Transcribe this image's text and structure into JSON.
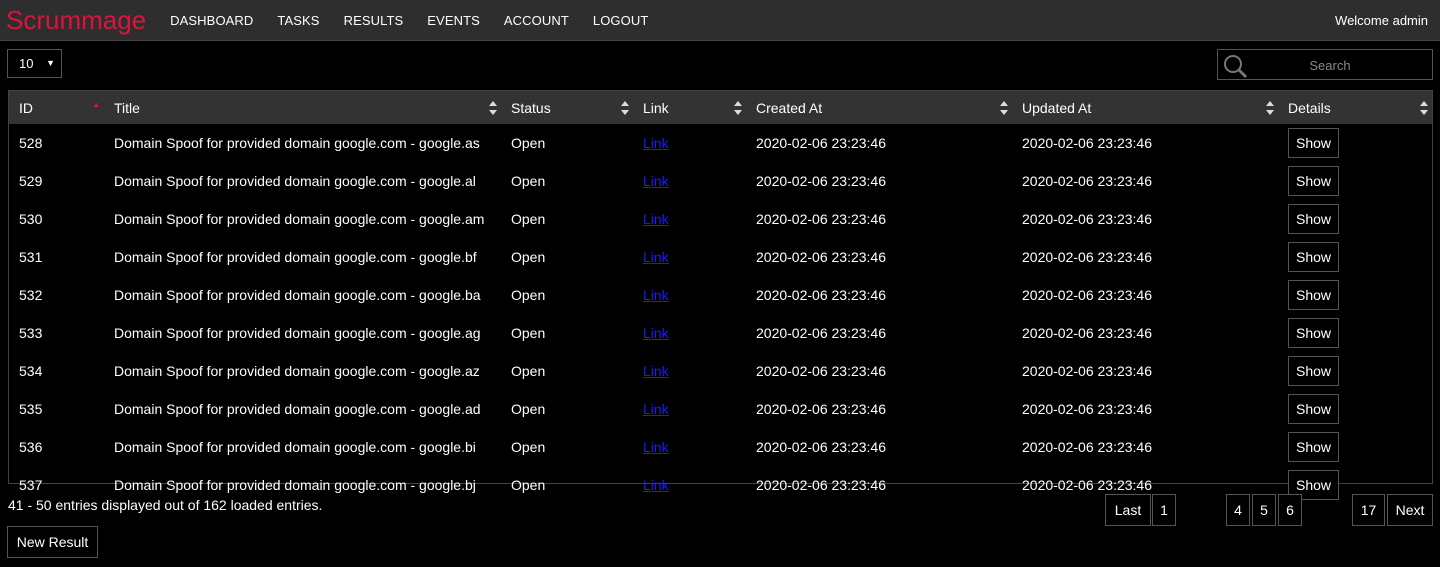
{
  "nav": {
    "brand": "Scrummage",
    "items": [
      "DASHBOARD",
      "TASKS",
      "RESULTS",
      "EVENTS",
      "ACCOUNT",
      "LOGOUT"
    ],
    "welcome": "Welcome admin"
  },
  "controls": {
    "page_size": "10",
    "search_placeholder": "Search"
  },
  "table": {
    "columns": [
      "ID",
      "Title",
      "Status",
      "Link",
      "Created At",
      "Updated At",
      "Details"
    ],
    "rows": [
      {
        "id": "528",
        "title": "Domain Spoof for provided domain google.com - google.as",
        "status": "Open",
        "link": "Link",
        "created": "2020-02-06 23:23:46",
        "updated": "2020-02-06 23:23:46",
        "details": "Show"
      },
      {
        "id": "529",
        "title": "Domain Spoof for provided domain google.com - google.al",
        "status": "Open",
        "link": "Link",
        "created": "2020-02-06 23:23:46",
        "updated": "2020-02-06 23:23:46",
        "details": "Show"
      },
      {
        "id": "530",
        "title": "Domain Spoof for provided domain google.com - google.am",
        "status": "Open",
        "link": "Link",
        "created": "2020-02-06 23:23:46",
        "updated": "2020-02-06 23:23:46",
        "details": "Show"
      },
      {
        "id": "531",
        "title": "Domain Spoof for provided domain google.com - google.bf",
        "status": "Open",
        "link": "Link",
        "created": "2020-02-06 23:23:46",
        "updated": "2020-02-06 23:23:46",
        "details": "Show"
      },
      {
        "id": "532",
        "title": "Domain Spoof for provided domain google.com - google.ba",
        "status": "Open",
        "link": "Link",
        "created": "2020-02-06 23:23:46",
        "updated": "2020-02-06 23:23:46",
        "details": "Show"
      },
      {
        "id": "533",
        "title": "Domain Spoof for provided domain google.com - google.ag",
        "status": "Open",
        "link": "Link",
        "created": "2020-02-06 23:23:46",
        "updated": "2020-02-06 23:23:46",
        "details": "Show"
      },
      {
        "id": "534",
        "title": "Domain Spoof for provided domain google.com - google.az",
        "status": "Open",
        "link": "Link",
        "created": "2020-02-06 23:23:46",
        "updated": "2020-02-06 23:23:46",
        "details": "Show"
      },
      {
        "id": "535",
        "title": "Domain Spoof for provided domain google.com - google.ad",
        "status": "Open",
        "link": "Link",
        "created": "2020-02-06 23:23:46",
        "updated": "2020-02-06 23:23:46",
        "details": "Show"
      },
      {
        "id": "536",
        "title": "Domain Spoof for provided domain google.com - google.bi",
        "status": "Open",
        "link": "Link",
        "created": "2020-02-06 23:23:46",
        "updated": "2020-02-06 23:23:46",
        "details": "Show"
      },
      {
        "id": "537",
        "title": "Domain Spoof for provided domain google.com - google.bj",
        "status": "Open",
        "link": "Link",
        "created": "2020-02-06 23:23:46",
        "updated": "2020-02-06 23:23:46",
        "details": "Show"
      }
    ]
  },
  "footer": {
    "summary": "41 - 50 entries displayed out of 162 loaded entries.",
    "new_result": "New Result"
  },
  "pagination": [
    "Last",
    "1",
    "4",
    "5",
    "6",
    "17",
    "Next"
  ],
  "colors": {
    "brand": "#dc143c",
    "link": "#1a1aff",
    "background": "#000000",
    "navbar": "#2e2e2e"
  }
}
